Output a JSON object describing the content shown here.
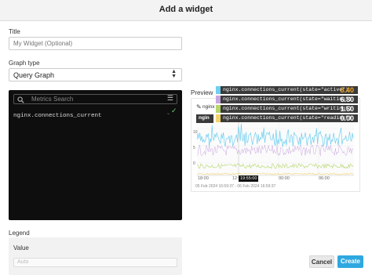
{
  "dialog": {
    "title": "Add a widget"
  },
  "title_field": {
    "label": "Title",
    "placeholder": "My Widget (Optional)"
  },
  "graph_type": {
    "label": "Graph type",
    "selected": "Query Graph"
  },
  "metrics": {
    "search_placeholder": "Metrics Search",
    "query": "nginx.connections_current"
  },
  "legend": {
    "label": "Legend",
    "value_label": "Value",
    "next_label": "Auto"
  },
  "preview": {
    "label": "Preview",
    "metric_tag": "nginx",
    "metric_tag2": "ngin",
    "time_cursor": "19:55:00",
    "time_range": "05 Feb 2024 16:59:37 - 06 Feb 2024 16:59:37",
    "legend_items": [
      {
        "text": "nginx.connections_current(state=\"active\")",
        "value": "8.40",
        "color": "#6ecff0",
        "value_color": "#f5a623"
      },
      {
        "text": "nginx.connections_current(state=\"waiting\")",
        "value": "6.80",
        "color": "#c9a7e0",
        "value_color": "#ffffff"
      },
      {
        "text": "nginx.connections_current(state=\"writing\")",
        "value": "1.60",
        "color": "#b5d66b",
        "value_color": "#ffffff"
      },
      {
        "text": "nginx.connections_current(state=\"reading\")",
        "value": "0.00",
        "color": "#f3d36b",
        "value_color": "#ffffff"
      }
    ],
    "x_ticks": [
      "18:00",
      "00:00",
      "06:00",
      "12:00"
    ],
    "y_ticks": [
      "10",
      "5",
      "0"
    ]
  },
  "buttons": {
    "cancel": "Cancel",
    "create": "Create"
  }
}
